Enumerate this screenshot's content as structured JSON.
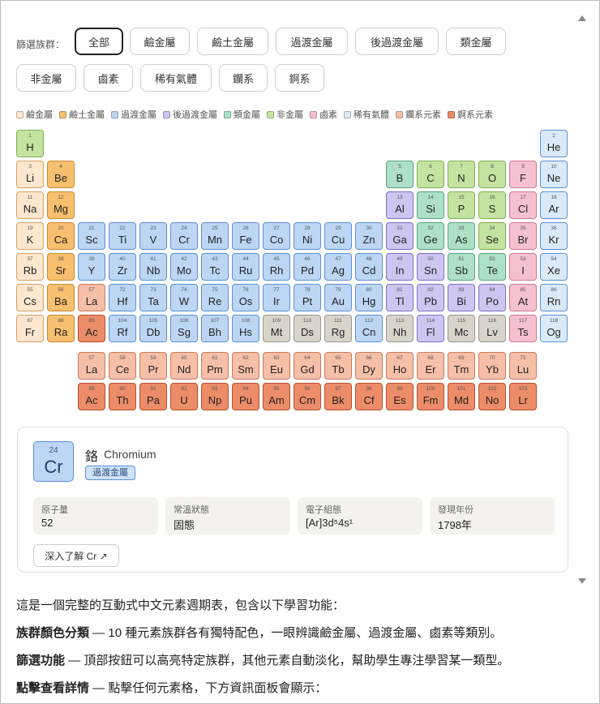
{
  "filter": {
    "label": "篩選族群：",
    "buttons": [
      "全部",
      "鹼金屬",
      "鹼土金屬",
      "過渡金屬",
      "後過渡金屬",
      "類金屬",
      "非金屬",
      "鹵素",
      "稀有氣體",
      "鑭系",
      "錒系"
    ],
    "active": "全部"
  },
  "legend": [
    {
      "label": "鹼金屬",
      "color": "#fde7cf"
    },
    {
      "label": "鹼土金屬",
      "color": "#f7bf6e"
    },
    {
      "label": "過渡金屬",
      "color": "#bcd6f4"
    },
    {
      "label": "後過渡金屬",
      "color": "#cdc6f0"
    },
    {
      "label": "類金屬",
      "color": "#aee0c7"
    },
    {
      "label": "非金屬",
      "color": "#c4e3a0"
    },
    {
      "label": "鹵素",
      "color": "#f5c1d0"
    },
    {
      "label": "稀有氣體",
      "color": "#dbeaf8"
    },
    {
      "label": "鑭系元素",
      "color": "#f5bfa8"
    },
    {
      "label": "錒系元素",
      "color": "#ec8c68"
    }
  ],
  "category_colors": {
    "nonmetal": {
      "bg": "#c4e3a0",
      "bd": "#7fae52"
    },
    "noble": {
      "bg": "#dbeaf8",
      "bd": "#5b8fd6"
    },
    "alkali": {
      "bg": "#fde7cf",
      "bd": "#d9a060"
    },
    "alkaline": {
      "bg": "#f7bf6e",
      "bd": "#c98a30"
    },
    "metalloid": {
      "bg": "#aee0c7",
      "bd": "#55a67d"
    },
    "halogen": {
      "bg": "#f5c1d0",
      "bd": "#d17894"
    },
    "transition": {
      "bg": "#bcd6f4",
      "bd": "#5b8fd6"
    },
    "post": {
      "bg": "#cdc6f0",
      "bd": "#7d70c8"
    },
    "lanth": {
      "bg": "#f5bfa8",
      "bd": "#cc7a5a"
    },
    "actin": {
      "bg": "#ec8c68",
      "bd": "#b5512e"
    },
    "unknown": {
      "bg": "#d8d4cc",
      "bd": "#9b968c"
    }
  },
  "elements": [
    [
      "1",
      "H",
      "nonmetal"
    ],
    [
      "2",
      "He",
      "noble"
    ],
    [
      "3",
      "Li",
      "alkali"
    ],
    [
      "4",
      "Be",
      "alkaline"
    ],
    [
      "5",
      "B",
      "metalloid"
    ],
    [
      "6",
      "C",
      "nonmetal"
    ],
    [
      "7",
      "N",
      "nonmetal"
    ],
    [
      "8",
      "O",
      "nonmetal"
    ],
    [
      "9",
      "F",
      "halogen"
    ],
    [
      "10",
      "Ne",
      "noble"
    ],
    [
      "11",
      "Na",
      "alkali"
    ],
    [
      "12",
      "Mg",
      "alkaline"
    ],
    [
      "13",
      "Al",
      "post"
    ],
    [
      "14",
      "Si",
      "metalloid"
    ],
    [
      "15",
      "P",
      "nonmetal"
    ],
    [
      "16",
      "S",
      "nonmetal"
    ],
    [
      "17",
      "Cl",
      "halogen"
    ],
    [
      "18",
      "Ar",
      "noble"
    ],
    [
      "19",
      "K",
      "alkali"
    ],
    [
      "20",
      "Ca",
      "alkaline"
    ],
    [
      "21",
      "Sc",
      "transition"
    ],
    [
      "22",
      "Ti",
      "transition"
    ],
    [
      "23",
      "V",
      "transition"
    ],
    [
      "24",
      "Cr",
      "transition"
    ],
    [
      "25",
      "Mn",
      "transition"
    ],
    [
      "26",
      "Fe",
      "transition"
    ],
    [
      "27",
      "Co",
      "transition"
    ],
    [
      "28",
      "Ni",
      "transition"
    ],
    [
      "29",
      "Cu",
      "transition"
    ],
    [
      "30",
      "Zn",
      "transition"
    ],
    [
      "31",
      "Ga",
      "post"
    ],
    [
      "32",
      "Ge",
      "metalloid"
    ],
    [
      "33",
      "As",
      "metalloid"
    ],
    [
      "34",
      "Se",
      "nonmetal"
    ],
    [
      "35",
      "Br",
      "halogen"
    ],
    [
      "36",
      "Kr",
      "noble"
    ],
    [
      "37",
      "Rb",
      "alkali"
    ],
    [
      "38",
      "Sr",
      "alkaline"
    ],
    [
      "39",
      "Y",
      "transition"
    ],
    [
      "40",
      "Zr",
      "transition"
    ],
    [
      "41",
      "Nb",
      "transition"
    ],
    [
      "42",
      "Mo",
      "transition"
    ],
    [
      "43",
      "Tc",
      "transition"
    ],
    [
      "44",
      "Ru",
      "transition"
    ],
    [
      "45",
      "Rh",
      "transition"
    ],
    [
      "46",
      "Pd",
      "transition"
    ],
    [
      "47",
      "Ag",
      "transition"
    ],
    [
      "48",
      "Cd",
      "transition"
    ],
    [
      "49",
      "In",
      "post"
    ],
    [
      "50",
      "Sn",
      "post"
    ],
    [
      "51",
      "Sb",
      "metalloid"
    ],
    [
      "52",
      "Te",
      "metalloid"
    ],
    [
      "53",
      "I",
      "halogen"
    ],
    [
      "54",
      "Xe",
      "noble"
    ],
    [
      "55",
      "Cs",
      "alkali"
    ],
    [
      "56",
      "Ba",
      "alkaline"
    ],
    [
      "57",
      "La",
      "lanth"
    ],
    [
      "72",
      "Hf",
      "transition"
    ],
    [
      "73",
      "Ta",
      "transition"
    ],
    [
      "74",
      "W",
      "transition"
    ],
    [
      "75",
      "Re",
      "transition"
    ],
    [
      "76",
      "Os",
      "transition"
    ],
    [
      "77",
      "Ir",
      "transition"
    ],
    [
      "78",
      "Pt",
      "transition"
    ],
    [
      "79",
      "Au",
      "transition"
    ],
    [
      "80",
      "Hg",
      "transition"
    ],
    [
      "81",
      "Tl",
      "post"
    ],
    [
      "82",
      "Pb",
      "post"
    ],
    [
      "83",
      "Bi",
      "post"
    ],
    [
      "84",
      "Po",
      "post"
    ],
    [
      "85",
      "At",
      "halogen"
    ],
    [
      "86",
      "Rn",
      "noble"
    ],
    [
      "87",
      "Fr",
      "alkali"
    ],
    [
      "88",
      "Ra",
      "alkaline"
    ],
    [
      "89",
      "Ac",
      "actin"
    ],
    [
      "104",
      "Rf",
      "transition"
    ],
    [
      "105",
      "Db",
      "transition"
    ],
    [
      "106",
      "Sg",
      "transition"
    ],
    [
      "107",
      "Bh",
      "transition"
    ],
    [
      "108",
      "Hs",
      "transition"
    ],
    [
      "109",
      "Mt",
      "unknown"
    ],
    [
      "110",
      "Ds",
      "unknown"
    ],
    [
      "111",
      "Rg",
      "unknown"
    ],
    [
      "112",
      "Cn",
      "transition"
    ],
    [
      "113",
      "Nh",
      "unknown"
    ],
    [
      "114",
      "Fl",
      "post"
    ],
    [
      "115",
      "Mc",
      "unknown"
    ],
    [
      "116",
      "Lv",
      "unknown"
    ],
    [
      "117",
      "Ts",
      "halogen"
    ],
    [
      "118",
      "Og",
      "noble"
    ],
    [
      "57",
      "La",
      "lanth"
    ],
    [
      "58",
      "Ce",
      "lanth"
    ],
    [
      "59",
      "Pr",
      "lanth"
    ],
    [
      "60",
      "Nd",
      "lanth"
    ],
    [
      "61",
      "Pm",
      "lanth"
    ],
    [
      "62",
      "Sm",
      "lanth"
    ],
    [
      "63",
      "Eu",
      "lanth"
    ],
    [
      "64",
      "Gd",
      "lanth"
    ],
    [
      "65",
      "Tb",
      "lanth"
    ],
    [
      "66",
      "Dy",
      "lanth"
    ],
    [
      "67",
      "Ho",
      "lanth"
    ],
    [
      "68",
      "Er",
      "lanth"
    ],
    [
      "69",
      "Tm",
      "lanth"
    ],
    [
      "70",
      "Yb",
      "lanth"
    ],
    [
      "71",
      "Lu",
      "lanth"
    ],
    [
      "89",
      "Ac",
      "actin"
    ],
    [
      "90",
      "Th",
      "actin"
    ],
    [
      "91",
      "Pa",
      "actin"
    ],
    [
      "92",
      "U",
      "actin"
    ],
    [
      "93",
      "Np",
      "actin"
    ],
    [
      "94",
      "Pu",
      "actin"
    ],
    [
      "95",
      "Am",
      "actin"
    ],
    [
      "96",
      "Cm",
      "actin"
    ],
    [
      "97",
      "Bk",
      "actin"
    ],
    [
      "98",
      "Cf",
      "actin"
    ],
    [
      "99",
      "Es",
      "actin"
    ],
    [
      "100",
      "Fm",
      "actin"
    ],
    [
      "101",
      "Md",
      "actin"
    ],
    [
      "102",
      "No",
      "actin"
    ],
    [
      "103",
      "Lr",
      "actin"
    ]
  ],
  "detail": {
    "number": "24",
    "symbol": "Cr",
    "name_zh": "鉻",
    "name_en": "Chromium",
    "category": "過渡金屬",
    "stats": [
      {
        "label": "原子量",
        "value": "52"
      },
      {
        "label": "常溫狀態",
        "value": "固態"
      },
      {
        "label": "電子組態",
        "value": "[Ar]3d⁵4s¹"
      },
      {
        "label": "發現年份",
        "value": "1798年"
      }
    ],
    "learn_more": "深入了解 Cr ↗"
  },
  "article": {
    "intro": "這是一個完整的互動式中文元素週期表，包含以下學習功能：",
    "items": [
      {
        "title": "族群顏色分類",
        "text": " — 10 種元素族群各有獨特配色，一眼辨識鹼金屬、過渡金屬、鹵素等類別。"
      },
      {
        "title": "篩選功能",
        "text": " — 頂部按鈕可以高亮特定族群，其他元素自動淡化，幫助學生專注學習某一類型。"
      },
      {
        "title": "點擊查看詳情",
        "text": " — 點擊任何元素格，下方資訊面板會顯示："
      }
    ]
  }
}
